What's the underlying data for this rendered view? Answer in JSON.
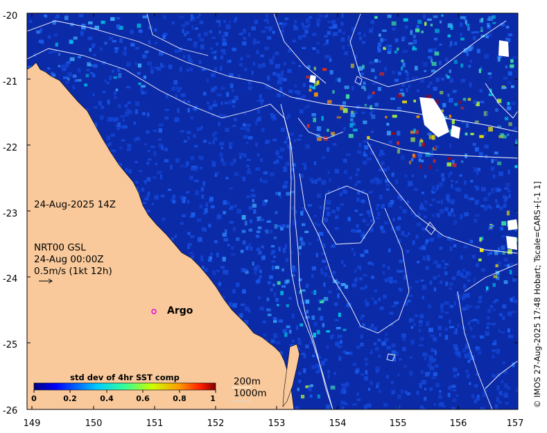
{
  "map": {
    "x_ticks": [
      "149",
      "150",
      "151",
      "152",
      "153",
      "154",
      "155",
      "156",
      "157"
    ],
    "y_ticks": [
      "-20",
      "-21",
      "-22",
      "-23",
      "-24",
      "-25",
      "-26"
    ],
    "lon_range": [
      149,
      157
    ],
    "lat_range": [
      -26,
      -20
    ],
    "land_color": "#f9c99b",
    "ocean_color": "#0b2aa8",
    "contour_color": "#ffffff"
  },
  "annotations": {
    "datetime": "24-Aug-2025 14Z",
    "product_line1": "NRT00 GSL",
    "product_line2": "24-Aug 00:00Z",
    "vector_scale": "0.5m/s (1kt 12h)",
    "argo_label": "Argo",
    "depth_200": "200m",
    "depth_1000": "1000m"
  },
  "colorbar": {
    "title": "std dev of 4hr SST comp",
    "ticks": [
      "0",
      "0.2",
      "0.4",
      "0.6",
      "0.8",
      "1"
    ],
    "range": [
      0,
      1
    ],
    "colormap": "jet"
  },
  "credit": "© IMOS 27-Aug-2025 17:48 Hobart; Tscale=CARS+[-1 1]"
}
